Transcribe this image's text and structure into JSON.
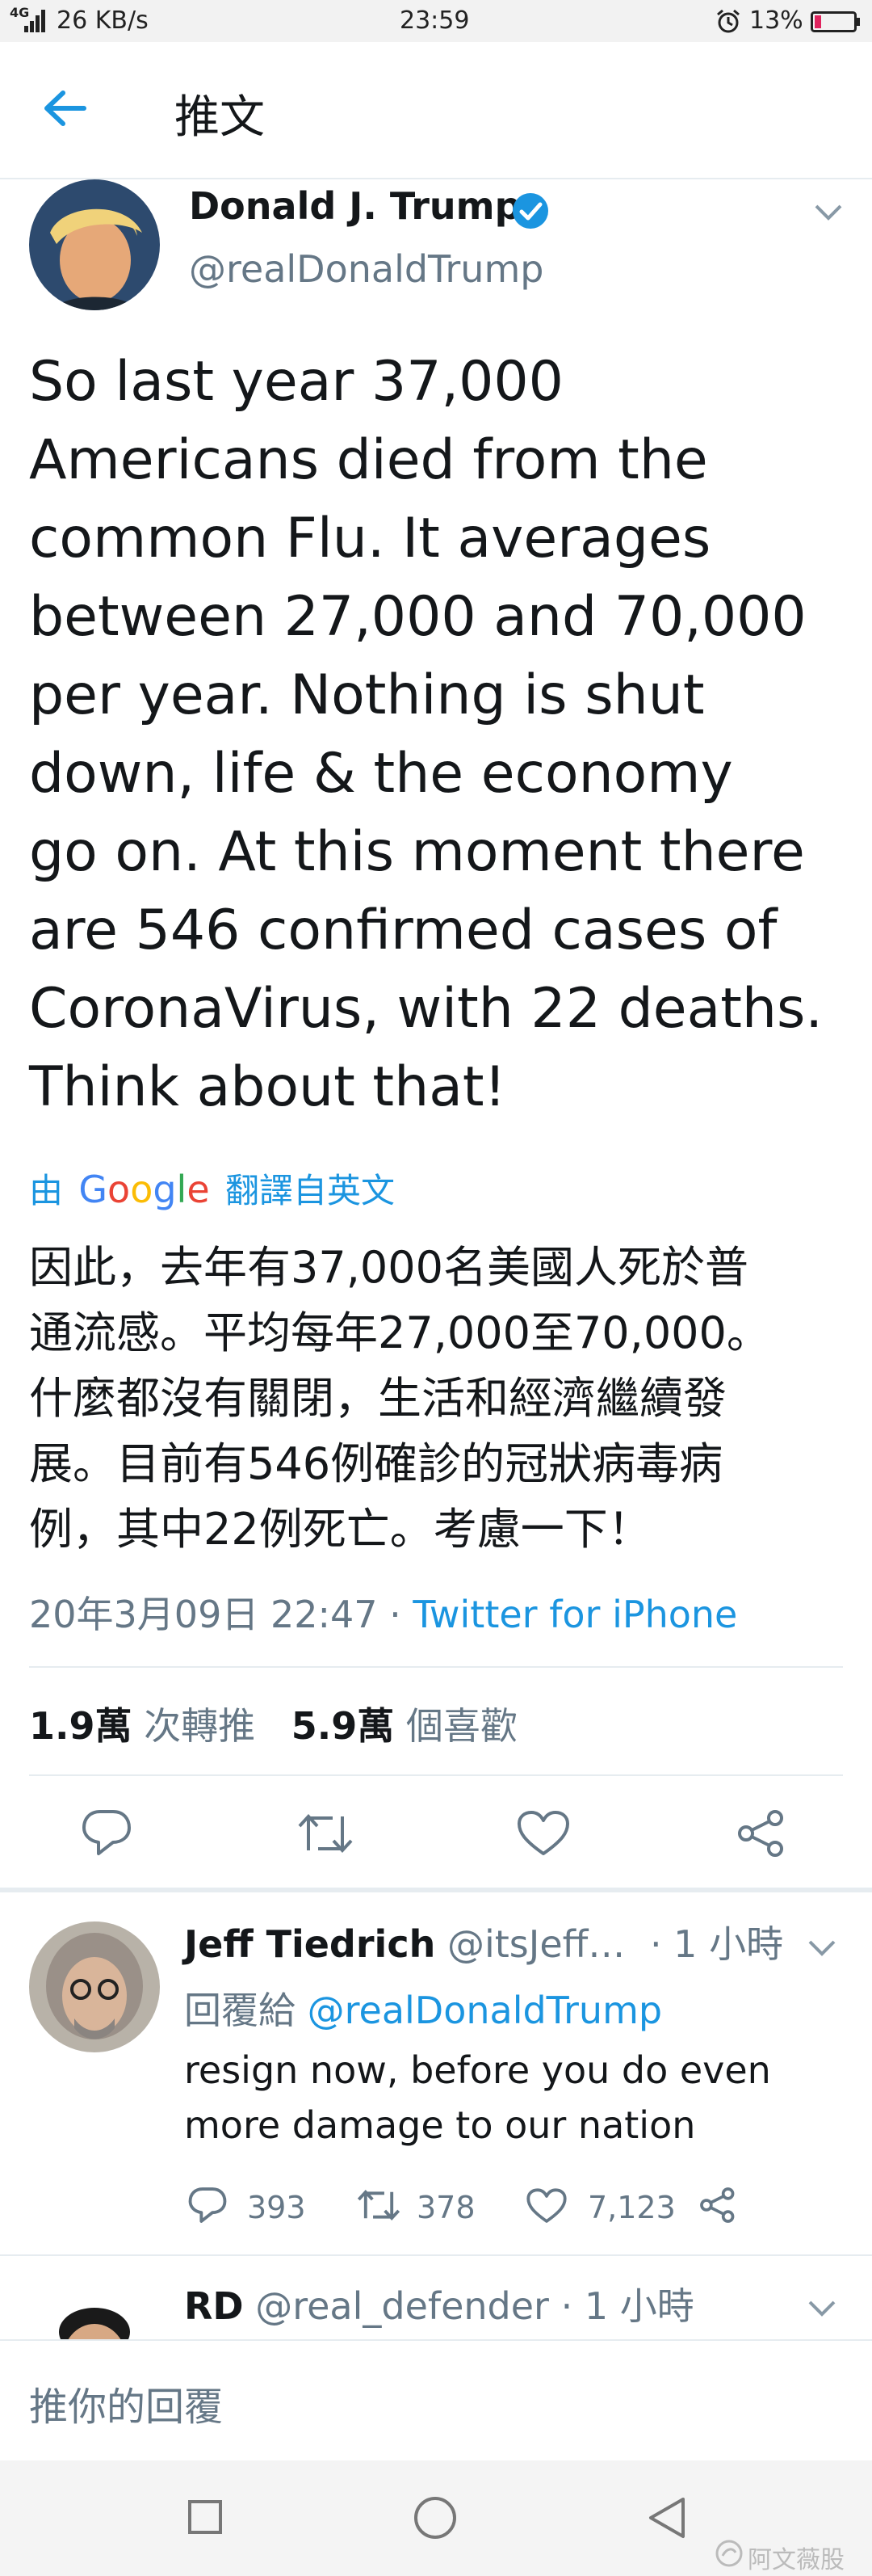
{
  "status_bar": {
    "network": "4G",
    "speed": "26 KB/s",
    "time": "23:59",
    "battery": "13%",
    "colors": {
      "battery_low": "#e0245e"
    }
  },
  "header": {
    "title": "推文"
  },
  "tweet": {
    "author_name": "Donald J. Trump",
    "author_handle": "@realDonaldTrump",
    "text_lines": [
      "So last year 37,000",
      "Americans died from the",
      "common Flu. It averages",
      "between 27,000 and 70,000",
      "per year. Nothing is shut",
      "down, life & the economy",
      "go on. At this moment there",
      "are 546 confirmed cases of",
      "CoronaVirus, with 22 deaths.",
      "Think about that!"
    ],
    "translate_prefix": "由",
    "translate_brand": "Google",
    "translate_suffix": "翻譯自英文",
    "translation_lines": [
      "因此，去年有37,000名美國人死於普",
      "通流感。平均每年27,000至70,000。",
      "什麼都沒有關閉，生活和經濟繼續發",
      "展。目前有546例確診的冠狀病毒病",
      "例，其中22例死亡。考慮一下！"
    ],
    "timestamp": "20年3月09日 22:47",
    "separator": "·",
    "source": "Twitter for iPhone",
    "retweets_count": "1.9萬",
    "retweets_label": "次轉推",
    "likes_count": "5.9萬",
    "likes_label": "個喜歡"
  },
  "replies": [
    {
      "name": "Jeff Tiedrich",
      "handle": "@itsJeff…",
      "time": "· 1 小時",
      "replying_prefix": "回覆給",
      "replying_to": "@realDonaldTrump",
      "text_lines": [
        "resign now, before you do even",
        "more damage to our nation"
      ],
      "replies": "393",
      "retweets": "378",
      "likes": "7,123"
    },
    {
      "name": "RD",
      "handle": "@real_defender",
      "time": "· 1 小時"
    }
  ],
  "reply_bar": {
    "placeholder": "推你的回覆"
  },
  "watermark": "阿文薇股",
  "colors": {
    "accent": "#1b95e0",
    "muted": "#657786",
    "border": "#e6ecf0"
  }
}
